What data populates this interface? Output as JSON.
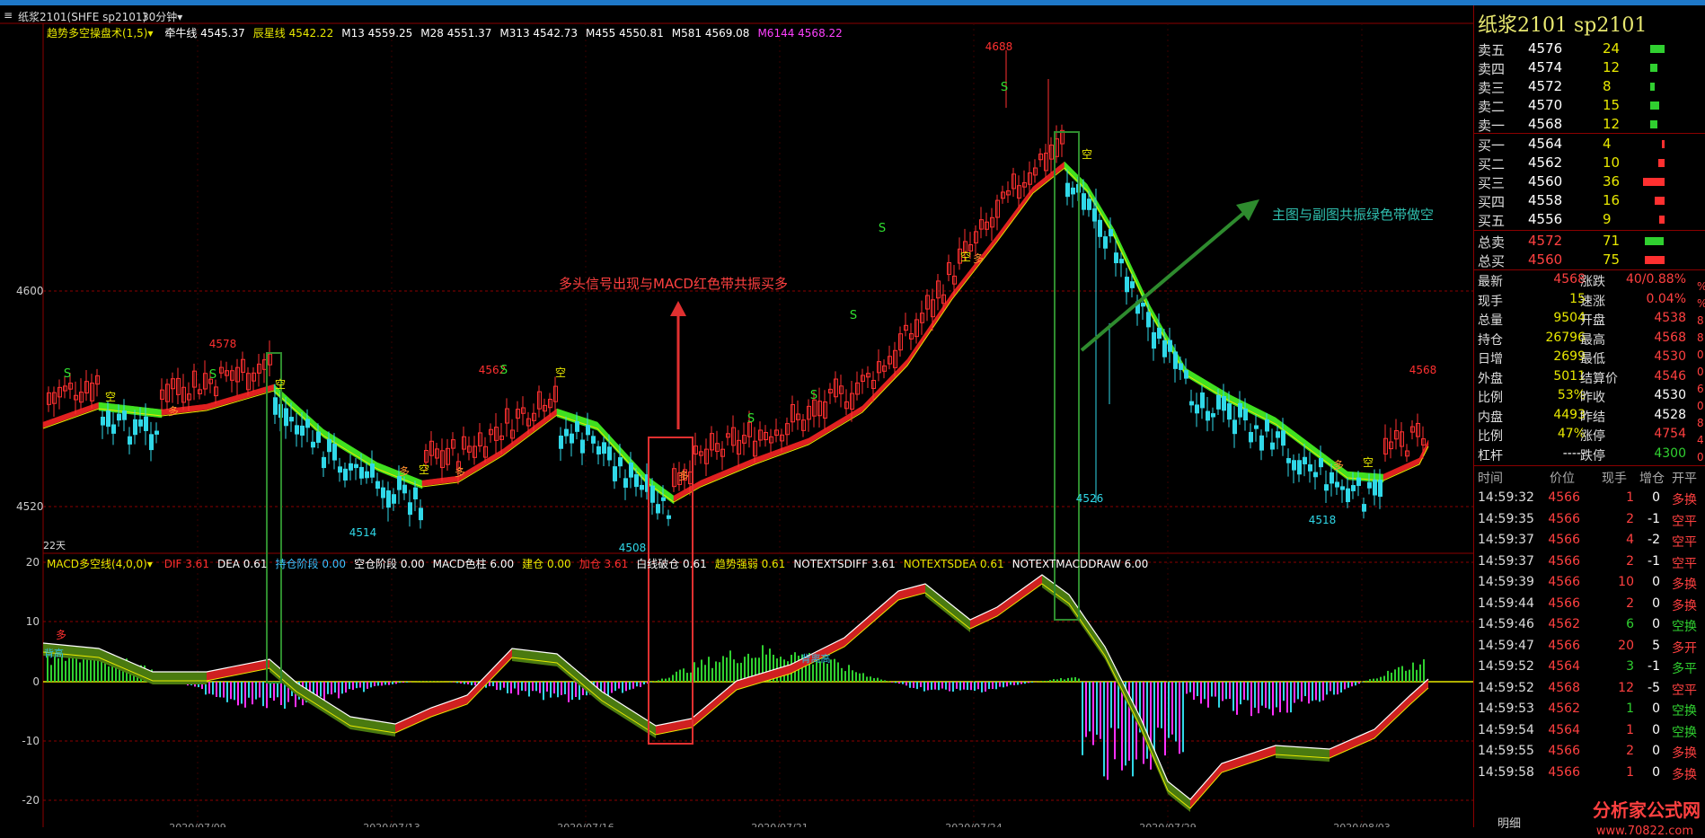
{
  "titlebar": {
    "symbol": "纸浆2101(SHFE sp2101)",
    "period": "30分钟",
    "chevron": "chevron-down"
  },
  "indicator_line": {
    "name": "趋势多空操盘术(1,5)",
    "items": [
      {
        "label": "牵牛线 4545.37",
        "color": "#ffffff"
      },
      {
        "label": "辰星线 4542.22",
        "color": "#e8e800"
      },
      {
        "label": "M13 4559.25",
        "color": "#ffffff"
      },
      {
        "label": "M28 4551.37",
        "color": "#ffffff"
      },
      {
        "label": "M313 4542.73",
        "color": "#ffffff"
      },
      {
        "label": "M455 4550.81",
        "color": "#ffffff"
      },
      {
        "label": "M581 4569.08",
        "color": "#ffffff"
      },
      {
        "label": "M6144 4568.22",
        "color": "#ff40ff"
      }
    ]
  },
  "macd_line": {
    "name": "MACD多空线(4,0,0)",
    "items": [
      {
        "label": "DIF 3.61",
        "color": "#ff3030"
      },
      {
        "label": "DEA 0.61",
        "color": "#ffffff"
      },
      {
        "label": "持仓阶段 0.00",
        "color": "#40c0ff"
      },
      {
        "label": "空仓阶段 0.00",
        "color": "#ffffff"
      },
      {
        "label": "MACD色柱 6.00",
        "color": "#ffffff"
      },
      {
        "label": "建仓 0.00",
        "color": "#e8e800"
      },
      {
        "label": "加仓 3.61",
        "color": "#ff3030"
      },
      {
        "label": "白线破仓 0.61",
        "color": "#ffffff"
      },
      {
        "label": "趋势强弱 0.61",
        "color": "#e8e800"
      },
      {
        "label": "NOTEXTSDIFF 3.61",
        "color": "#ffffff"
      },
      {
        "label": "NOTEXTSDEA 0.61",
        "color": "#e8e800"
      },
      {
        "label": "NOTEXTMACDDRAW 6.00",
        "color": "#ffffff"
      }
    ]
  },
  "main_axis": {
    "labels": [
      "4600",
      "4520"
    ]
  },
  "macd_axis": {
    "labels": [
      "20",
      "10",
      "0",
      "-10",
      "-20"
    ]
  },
  "date_labels": [
    "2020/07/09",
    "2020/07/13",
    "2020/07/16",
    "2020/07/21",
    "2020/07/24",
    "2020/07/29",
    "2020/08/03"
  ],
  "price_marks": [
    "4578",
    "4562",
    "4514",
    "4508",
    "4688",
    "4526",
    "4518",
    "4568"
  ],
  "day_count": "22天",
  "annotations": {
    "long": "多头信号出现与MACD红色带共振买多",
    "short": "主图与副图共振绿色带做空"
  },
  "signal_glyphs": {
    "s": "S",
    "kong": "空",
    "duo": "多",
    "macd_duo": "多",
    "macd_high1": "背高",
    "macd_high2": "背离高"
  },
  "right_panel": {
    "title": "纸浆2101 sp2101",
    "asks": [
      {
        "label": "卖五",
        "price": "4576",
        "qty": "24",
        "bar": 1.0
      },
      {
        "label": "卖四",
        "price": "4574",
        "qty": "12",
        "bar": 0.5
      },
      {
        "label": "卖三",
        "price": "4572",
        "qty": "8",
        "bar": 0.33
      },
      {
        "label": "卖二",
        "price": "4570",
        "qty": "15",
        "bar": 0.62
      },
      {
        "label": "卖一",
        "price": "4568",
        "qty": "12",
        "bar": 0.5
      }
    ],
    "bids": [
      {
        "label": "买一",
        "price": "4564",
        "qty": "4",
        "bar": 0.11
      },
      {
        "label": "买二",
        "price": "4562",
        "qty": "10",
        "bar": 0.28
      },
      {
        "label": "买三",
        "price": "4560",
        "qty": "36",
        "bar": 1.0
      },
      {
        "label": "买四",
        "price": "4558",
        "qty": "16",
        "bar": 0.44
      },
      {
        "label": "买五",
        "price": "4556",
        "qty": "9",
        "bar": 0.25
      }
    ],
    "totals": [
      {
        "label": "总卖",
        "price": "4572",
        "qty": "71",
        "color": "#30d030",
        "bar": 0.95
      },
      {
        "label": "总买",
        "price": "4560",
        "qty": "75",
        "color": "#ff3030",
        "bar": 1.0
      }
    ],
    "stats": [
      {
        "l1": "最新",
        "v1": "4568",
        "c1": "#ff4040",
        "l2": "涨跌",
        "v2": "40/0.88%",
        "c2": "#ff4040"
      },
      {
        "l1": "现手",
        "v1": "15",
        "c1": "#e8e800",
        "l2": "速涨",
        "v2": "0.04%",
        "c2": "#ff4040"
      },
      {
        "l1": "总量",
        "v1": "9504",
        "c1": "#e8e800",
        "l2": "开盘",
        "v2": "4538",
        "c2": "#ff4040"
      },
      {
        "l1": "持仓",
        "v1": "26796",
        "c1": "#e8e800",
        "l2": "最高",
        "v2": "4568",
        "c2": "#ff4040"
      },
      {
        "l1": "日增",
        "v1": "2699",
        "c1": "#e8e800",
        "l2": "最低",
        "v2": "4530",
        "c2": "#ff4040"
      },
      {
        "l1": "外盘",
        "v1": "5011",
        "c1": "#e8e800",
        "l2": "结算价",
        "v2": "4546",
        "c2": "#ff4040"
      },
      {
        "l1": "比例",
        "v1": "53%",
        "c1": "#e8e800",
        "l2": "昨收",
        "v2": "4530",
        "c2": "#ffffff"
      },
      {
        "l1": "内盘",
        "v1": "4493",
        "c1": "#e8e800",
        "l2": "昨结",
        "v2": "4528",
        "c2": "#ffffff"
      },
      {
        "l1": "比例",
        "v1": "47%",
        "c1": "#e8e800",
        "l2": "涨停",
        "v2": "4754",
        "c2": "#ff4040"
      },
      {
        "l1": "杠杆",
        "v1": "-----",
        "c1": "#ffffff",
        "l2": "跌停",
        "v2": "4300",
        "c2": "#30d030"
      }
    ],
    "side_marks": [
      "%",
      "%",
      "8",
      "8",
      "0",
      "0",
      "6",
      "0",
      "8",
      "4",
      "0"
    ],
    "tick_header": [
      "时间",
      "价位",
      "现手",
      "增仓",
      "开平"
    ],
    "ticks": [
      {
        "t": "14:59:32",
        "p": "4566",
        "v": "1",
        "vc": "#ff4040",
        "d": "0",
        "k": "多换",
        "kc": "#ff4040"
      },
      {
        "t": "14:59:35",
        "p": "4566",
        "v": "2",
        "vc": "#ff4040",
        "d": "-1",
        "k": "空平",
        "kc": "#ff4040"
      },
      {
        "t": "14:59:37",
        "p": "4566",
        "v": "4",
        "vc": "#ff4040",
        "d": "-2",
        "k": "空平",
        "kc": "#ff4040"
      },
      {
        "t": "14:59:37",
        "p": "4566",
        "v": "2",
        "vc": "#ff4040",
        "d": "-1",
        "k": "空平",
        "kc": "#ff4040"
      },
      {
        "t": "14:59:39",
        "p": "4566",
        "v": "10",
        "vc": "#ff4040",
        "d": "0",
        "k": "多换",
        "kc": "#ff4040"
      },
      {
        "t": "14:59:44",
        "p": "4566",
        "v": "2",
        "vc": "#ff4040",
        "d": "0",
        "k": "多换",
        "kc": "#ff4040"
      },
      {
        "t": "14:59:46",
        "p": "4562",
        "v": "6",
        "vc": "#30d030",
        "d": "0",
        "k": "空换",
        "kc": "#30d030"
      },
      {
        "t": "14:59:47",
        "p": "4566",
        "v": "20",
        "vc": "#ff4040",
        "d": "5",
        "k": "多开",
        "kc": "#ff4040"
      },
      {
        "t": "14:59:52",
        "p": "4564",
        "v": "3",
        "vc": "#30d030",
        "d": "-1",
        "k": "多平",
        "kc": "#30d030"
      },
      {
        "t": "14:59:52",
        "p": "4568",
        "v": "12",
        "vc": "#ff4040",
        "d": "-5",
        "k": "空平",
        "kc": "#ff4040"
      },
      {
        "t": "14:59:53",
        "p": "4562",
        "v": "1",
        "vc": "#30d030",
        "d": "0",
        "k": "空换",
        "kc": "#30d030"
      },
      {
        "t": "14:59:54",
        "p": "4564",
        "v": "1",
        "vc": "#ff4040",
        "d": "0",
        "k": "空换",
        "kc": "#30d030"
      },
      {
        "t": "14:59:55",
        "p": "4566",
        "v": "2",
        "vc": "#ff4040",
        "d": "0",
        "k": "多换",
        "kc": "#ff4040"
      },
      {
        "t": "14:59:58",
        "p": "4566",
        "v": "1",
        "vc": "#ff4040",
        "d": "0",
        "k": "多换",
        "kc": "#ff4040"
      }
    ],
    "bottom_tab": "明细",
    "watermark": "分析家公式网",
    "watermark_url": "www.70822.com"
  },
  "colors": {
    "up": "#ff3030",
    "down": "#30d8e8",
    "green": "#30d030",
    "band_green": "#40e020",
    "band_red": "#e02020",
    "grid": "#8b0000"
  }
}
